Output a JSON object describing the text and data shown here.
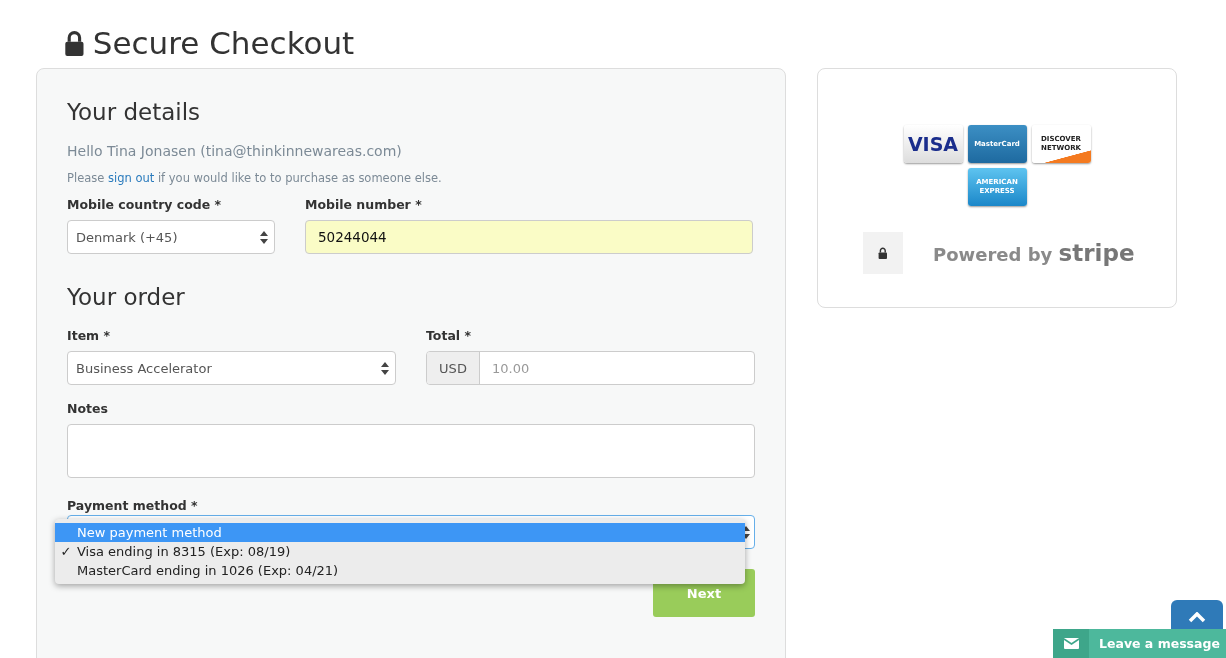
{
  "title": "Secure Checkout",
  "details": {
    "heading": "Your details",
    "greeting": "Hello Tina Jonasen (tina@thinkinnewareas.com)",
    "signout_before": "Please",
    "signout_link": "sign out",
    "signout_after": "if you would like to to purchase as someone else.",
    "country_label": "Mobile country code *",
    "country_value": "Denmark (+45)",
    "mobile_label": "Mobile number *",
    "mobile_value": "50244044"
  },
  "order": {
    "heading": "Your order",
    "item_label": "Item *",
    "item_value": "Business Accelerator",
    "total_label": "Total *",
    "currency": "USD",
    "total_placeholder": "10.00",
    "notes_label": "Notes"
  },
  "payment": {
    "label": "Payment method *",
    "options": [
      {
        "label": "New payment method",
        "selected": true,
        "checked": false
      },
      {
        "label": "Visa ending in 8315 (Exp: 08/19)",
        "selected": false,
        "checked": true
      },
      {
        "label": "MasterCard ending in 1026 (Exp: 04/21)",
        "selected": false,
        "checked": false
      }
    ],
    "check_mark": "✓"
  },
  "next_button": "Next",
  "cards": [
    {
      "kind": "visa",
      "lines": [
        "VISA"
      ]
    },
    {
      "kind": "mastercard",
      "lines": [
        "MasterCard"
      ]
    },
    {
      "kind": "discover",
      "lines": [
        "DISCOVER",
        "NETWORK"
      ]
    },
    {
      "kind": "amex",
      "lines": [
        "AMERICAN",
        "EXPRESS"
      ]
    }
  ],
  "stripe": {
    "prefix": "Powered by",
    "brand": "stripe"
  },
  "chat": {
    "label": "Leave a message"
  }
}
